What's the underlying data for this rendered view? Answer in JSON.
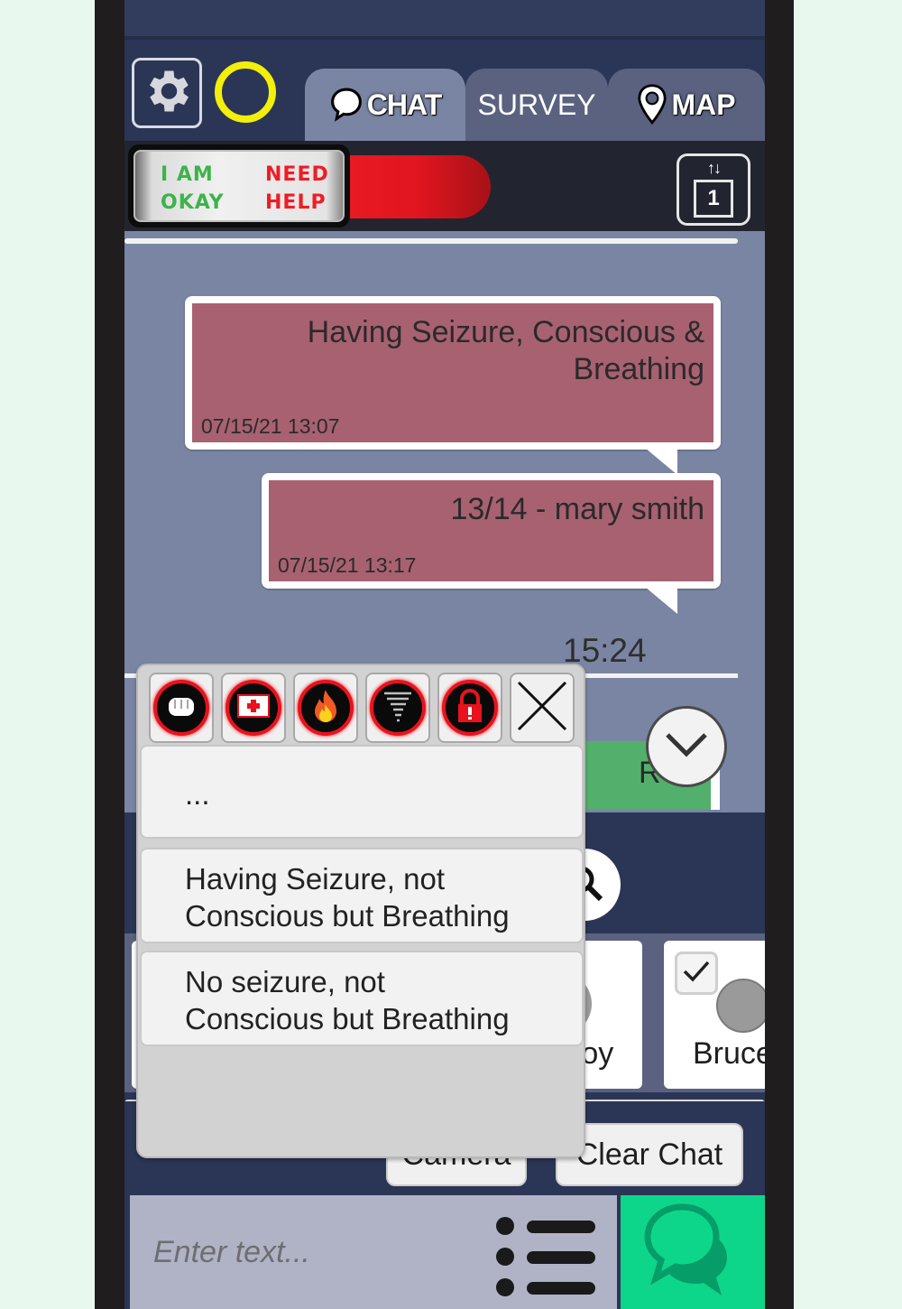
{
  "colors": {
    "background": "#e8f8ee",
    "screen_bg": "#2b3556",
    "chat_bg": "#7a85a3",
    "bubble_fill": "#a86170",
    "status_ring": "#f2ef0a",
    "ok_green": "#3db34a",
    "help_red": "#ee1c25",
    "send_green": "#0dd68a"
  },
  "header": {
    "settings_icon": "gear-icon",
    "status_indicator": "yellow-ring",
    "tabs": [
      {
        "label": "CHAT",
        "icon": "speech-bubble-icon",
        "active": true
      },
      {
        "label": "SURVEY",
        "icon": "",
        "active": false
      },
      {
        "label": "MAP",
        "icon": "map-pin-icon",
        "active": false
      }
    ]
  },
  "help_toggle": {
    "okay_label_line1": "I AM",
    "okay_label_line2": "OKAY",
    "help_label_line1": "NEED",
    "help_label_line2": "HELP",
    "state": "need-help"
  },
  "sort_button": {
    "arrows": "↑↓",
    "value": "1"
  },
  "chat": {
    "messages": [
      {
        "text_line1": "Having Seizure, Conscious &",
        "text_line2": "Breathing",
        "timestamp": "07/15/21 13:07"
      },
      {
        "text_line1": "13/14 - mary smith",
        "text_line2": "",
        "timestamp": "07/15/21 13:17"
      }
    ],
    "time_label": "15:24",
    "partial_button_label": "R"
  },
  "popup": {
    "icons": [
      {
        "name": "fist-icon",
        "label": "Assault"
      },
      {
        "name": "first-aid-icon",
        "label": "Medical"
      },
      {
        "name": "fire-icon",
        "label": "Fire"
      },
      {
        "name": "tornado-icon",
        "label": "Weather"
      },
      {
        "name": "lock-alert-icon",
        "label": "Lockdown"
      }
    ],
    "close_label": "X",
    "options": [
      {
        "line1": "...",
        "line2": ""
      },
      {
        "line1": "Having Seizure, not",
        "line2": "Conscious but Breathing"
      },
      {
        "line1": "No seizure, not",
        "line2": "Conscious but Breathing"
      }
    ]
  },
  "contacts": [
    {
      "name": "...oy",
      "checked": false
    },
    {
      "name": "Bruce",
      "checked": true
    }
  ],
  "actions": {
    "camera_label": "Camera",
    "clear_chat_label": "Clear Chat"
  },
  "composer": {
    "placeholder": "Enter text...",
    "value": ""
  }
}
